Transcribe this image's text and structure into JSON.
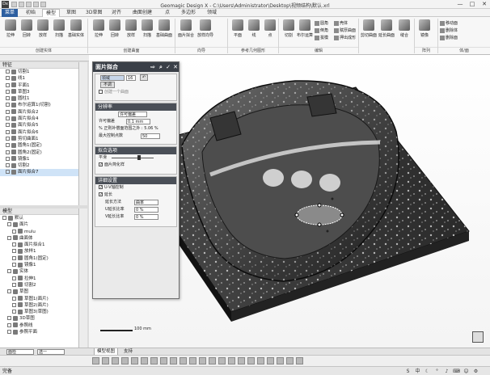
{
  "window": {
    "title": "Geomagic Design X - C:\\Users\\Administrator\\Desktop\\视频结构\\默认.xrl",
    "app_icon": "Dx",
    "minimize": "—",
    "maximize": "□",
    "close": "✕"
  },
  "menu": {
    "tabs": [
      "菜单",
      "初始",
      "模型",
      "草图",
      "3D草图",
      "对齐",
      "曲面创建",
      "点",
      "多边形",
      "领域"
    ]
  },
  "ribbon": {
    "tools": [
      {
        "label": "拉伸",
        "icon": "extrude-icon"
      },
      {
        "label": "回转",
        "icon": "revolve-icon"
      },
      {
        "label": "放样",
        "icon": "loft-icon"
      },
      {
        "label": "扫描",
        "icon": "sweep-icon"
      },
      {
        "label": "基础实体",
        "icon": "primitive-solid-icon"
      },
      {
        "label": "拉伸",
        "icon": "extrude-surface-icon"
      },
      {
        "label": "回转",
        "icon": "revolve-surface-icon"
      },
      {
        "label": "放样",
        "icon": "loft-surface-icon"
      },
      {
        "label": "扫描",
        "icon": "sweep-surface-icon"
      },
      {
        "label": "基础曲面",
        "icon": "primitive-surface-icon"
      },
      {
        "label": "面片拟合",
        "icon": "mesh-fit-icon"
      },
      {
        "label": "放样向导",
        "icon": "loft-wizard-icon"
      },
      {
        "label": "平面",
        "icon": "plane-icon"
      },
      {
        "label": "线",
        "icon": "line-icon"
      },
      {
        "label": "点",
        "icon": "point-icon"
      },
      {
        "label": "切割",
        "icon": "cut-icon"
      },
      {
        "label": "布尔运算",
        "icon": "boolean-icon"
      },
      {
        "label": "剪切曲面",
        "icon": "trim-surface-icon"
      },
      {
        "label": "延长曲面",
        "icon": "extend-surface-icon"
      },
      {
        "label": "缝合",
        "icon": "stitch-icon"
      },
      {
        "label": "镜像",
        "icon": "mirror-icon"
      }
    ],
    "small_tools": [
      "圆角",
      "倒角",
      "拔模",
      "壳体",
      "赋厚曲面",
      "押出成形",
      "移动面",
      "删除体",
      "删除面"
    ],
    "groups": [
      "创建实体",
      "创建曲面",
      "向导",
      "参考几何图形",
      "编辑",
      "阵列",
      "体/面"
    ]
  },
  "feature_tree": {
    "title": "特征",
    "items": [
      {
        "label": "切割1",
        "icon": "cut-feature-icon"
      },
      {
        "label": "线1",
        "icon": "line-feature-icon"
      },
      {
        "label": "平面1",
        "icon": "plane-feature-icon"
      },
      {
        "label": "草图3",
        "icon": "sketch-icon"
      },
      {
        "label": "圆柱1",
        "icon": "cylinder-icon"
      },
      {
        "label": "布尔运算1(切割)",
        "icon": "boolean-feature-icon"
      },
      {
        "label": "面片拟合2",
        "icon": "mesh-fit-feature-icon"
      },
      {
        "label": "面片拟合4",
        "icon": "mesh-fit-feature-icon"
      },
      {
        "label": "面片拟合5",
        "icon": "mesh-fit-feature-icon"
      },
      {
        "label": "面片拟合6",
        "icon": "mesh-fit-feature-icon"
      },
      {
        "label": "剪切曲面1",
        "icon": "trim-feature-icon"
      },
      {
        "label": "圆角1(固定)",
        "icon": "fillet-feature-icon"
      },
      {
        "label": "圆角2(固定)",
        "icon": "fillet-feature-icon"
      },
      {
        "label": "镜像1",
        "icon": "mirror-feature-icon"
      },
      {
        "label": "切割2",
        "icon": "cut-feature-icon"
      },
      {
        "label": "面片拟合7",
        "icon": "mesh-fit-feature-icon"
      }
    ]
  },
  "model_tree": {
    "title": "模型",
    "items": [
      {
        "label": "默认",
        "indent": 0,
        "icon": "model-root-icon"
      },
      {
        "label": "面片",
        "indent": 1,
        "icon": "mesh-icon"
      },
      {
        "label": "mulu",
        "indent": 2,
        "icon": "mesh-item-icon"
      },
      {
        "label": "曲面体",
        "indent": 1,
        "icon": "surface-body-icon"
      },
      {
        "label": "面片拟合1",
        "indent": 2,
        "icon": "surface-item-icon"
      },
      {
        "label": "放样1",
        "indent": 2,
        "icon": "surface-item-icon"
      },
      {
        "label": "圆角1(固定)",
        "indent": 2,
        "icon": "surface-item-icon"
      },
      {
        "label": "镜像1",
        "indent": 2,
        "icon": "surface-item-icon"
      },
      {
        "label": "实体",
        "indent": 1,
        "icon": "solid-body-icon"
      },
      {
        "label": "拉伸1",
        "indent": 2,
        "icon": "solid-item-icon"
      },
      {
        "label": "切割2",
        "indent": 2,
        "icon": "solid-item-icon"
      },
      {
        "label": "草图",
        "indent": 1,
        "icon": "sketch-folder-icon"
      },
      {
        "label": "草图1(面片)",
        "indent": 2,
        "icon": "sketch-item-icon"
      },
      {
        "label": "草图2(面片)",
        "indent": 2,
        "icon": "sketch-item-icon"
      },
      {
        "label": "草图3(草图)",
        "indent": 2,
        "icon": "sketch-item-icon"
      },
      {
        "label": "3D草图",
        "indent": 1,
        "icon": "sketch3d-folder-icon"
      },
      {
        "label": "参照线",
        "indent": 1,
        "icon": "ref-line-folder-icon"
      },
      {
        "label": "参照平面",
        "indent": 1,
        "icon": "ref-plane-folder-icon"
      }
    ]
  },
  "dialog": {
    "title": "面片拟合",
    "region_field": "领域",
    "region_count": "16",
    "toggle_label": "不调",
    "create_face_label": "创建一个曲面",
    "resolution": {
      "header": "分辨率",
      "mode_value": "许可偏差",
      "allowed_dev_label": "许可偏差",
      "allowed_dev_value": "0.1 mm",
      "area_ratio_label": "% 正则补偿面范围之外 : 5.06 %",
      "max_ctrl_label": "最大控制点数",
      "max_ctrl_value": "50"
    },
    "fit_options": {
      "header": "拟合选项",
      "smooth_label": "平滑",
      "sample_label": "面片简化样"
    },
    "details": {
      "header": "详细设置",
      "uv_checkbox": "U-V轴控制",
      "extend_checkbox": "延长",
      "extend_method_label": "延长方法",
      "extend_method_value": "曲率",
      "u_ratio_label": "U延长比率",
      "u_ratio_value": "0 %",
      "v_ratio_label": "V延长比率",
      "v_ratio_value": "0 %"
    }
  },
  "viewport": {
    "scale_label": "100 mm",
    "tabs": [
      "模型视图",
      "支持"
    ]
  },
  "left_bottom": {
    "mode_value": "面检",
    "unit_value": "选一"
  },
  "status": {
    "text": "完备"
  },
  "colors": {
    "part_dark": "#3a3a3a",
    "part_highlight": "#c9c9c9",
    "dialog_header": "#3a3f47",
    "menu_active": "#2d5fa0"
  }
}
